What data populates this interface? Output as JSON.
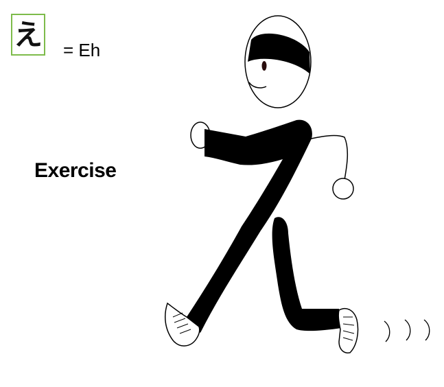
{
  "card": {
    "kana": "え",
    "reading": "= Eh",
    "word": "Exercise"
  },
  "colors": {
    "accent": "#7dbb4a",
    "ink": "#000000"
  }
}
